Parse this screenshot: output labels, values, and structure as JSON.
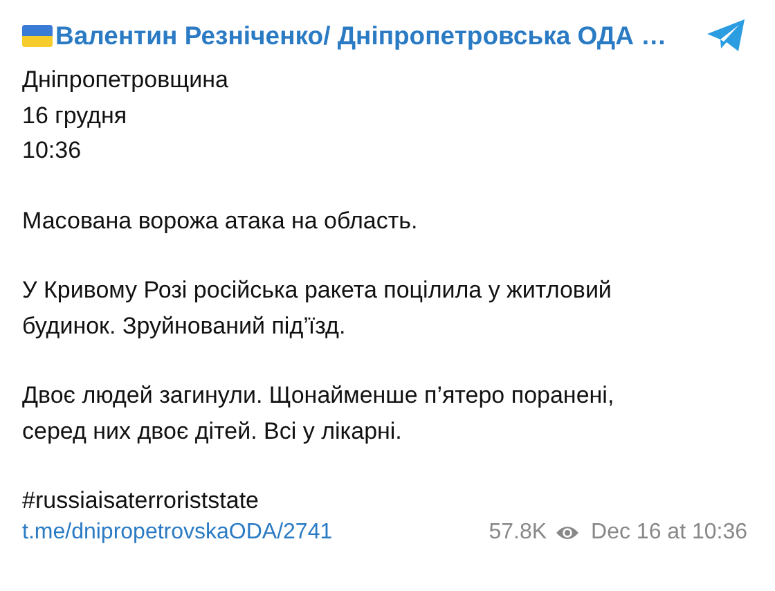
{
  "header": {
    "title": "Валентин Резніченко/ Дніпропетровська ОДА …"
  },
  "paragraphs": [
    {
      "lines": [
        "Дніпропетровщина",
        "16 грудня",
        "10:36"
      ]
    },
    {
      "lines": [
        "Масована ворожа атака на область."
      ]
    },
    {
      "lines": [
        "У Кривому Розі російська ракета поцілила у житловий",
        "будинок. Зруйнований під’їзд."
      ]
    },
    {
      "lines": [
        "Двоє людей загинули. Щонайменше п’ятеро поранені,",
        "серед них двоє дітей. Всі у лікарні."
      ]
    },
    {
      "lines": [
        "#russiaisaterroriststate"
      ]
    }
  ],
  "footer": {
    "link": "t.me/dnipropetrovskaODA/2741",
    "views": "57.8K",
    "date": "Dec 16 at 10:36"
  }
}
